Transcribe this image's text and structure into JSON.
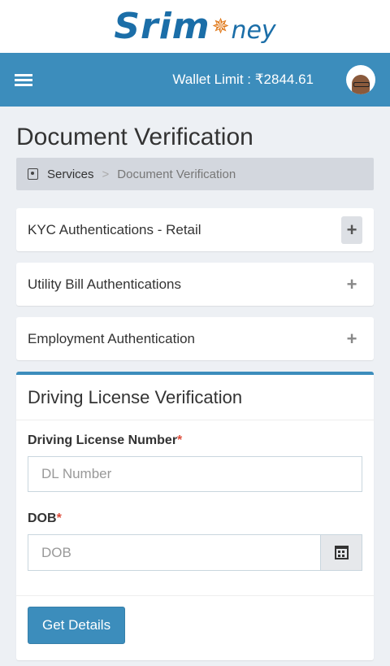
{
  "brand": {
    "logo_part1": "Srim",
    "logo_star": "✵",
    "logo_part2": "ney"
  },
  "header": {
    "wallet_label": "Wallet Limit : ",
    "currency": "₹",
    "wallet_amount": "2844.61"
  },
  "page": {
    "title": "Document Verification"
  },
  "breadcrumb": {
    "link": "Services",
    "separator": ">",
    "current": "Document Verification"
  },
  "panels": [
    {
      "title": "KYC Authentications - Retail",
      "icon": "+"
    },
    {
      "title": "Utility Bill Authentications",
      "icon": "+"
    },
    {
      "title": "Employment Authentication",
      "icon": "+"
    }
  ],
  "form": {
    "title": "Driving License Verification",
    "dl_label": "Driving License Number",
    "dl_placeholder": "DL Number",
    "dob_label": "DOB",
    "dob_placeholder": "DOB",
    "required_mark": "*",
    "submit_label": "Get Details"
  },
  "colors": {
    "primary": "#3c8dbc",
    "required": "#dd4b39",
    "page_bg": "#edf0f4"
  }
}
